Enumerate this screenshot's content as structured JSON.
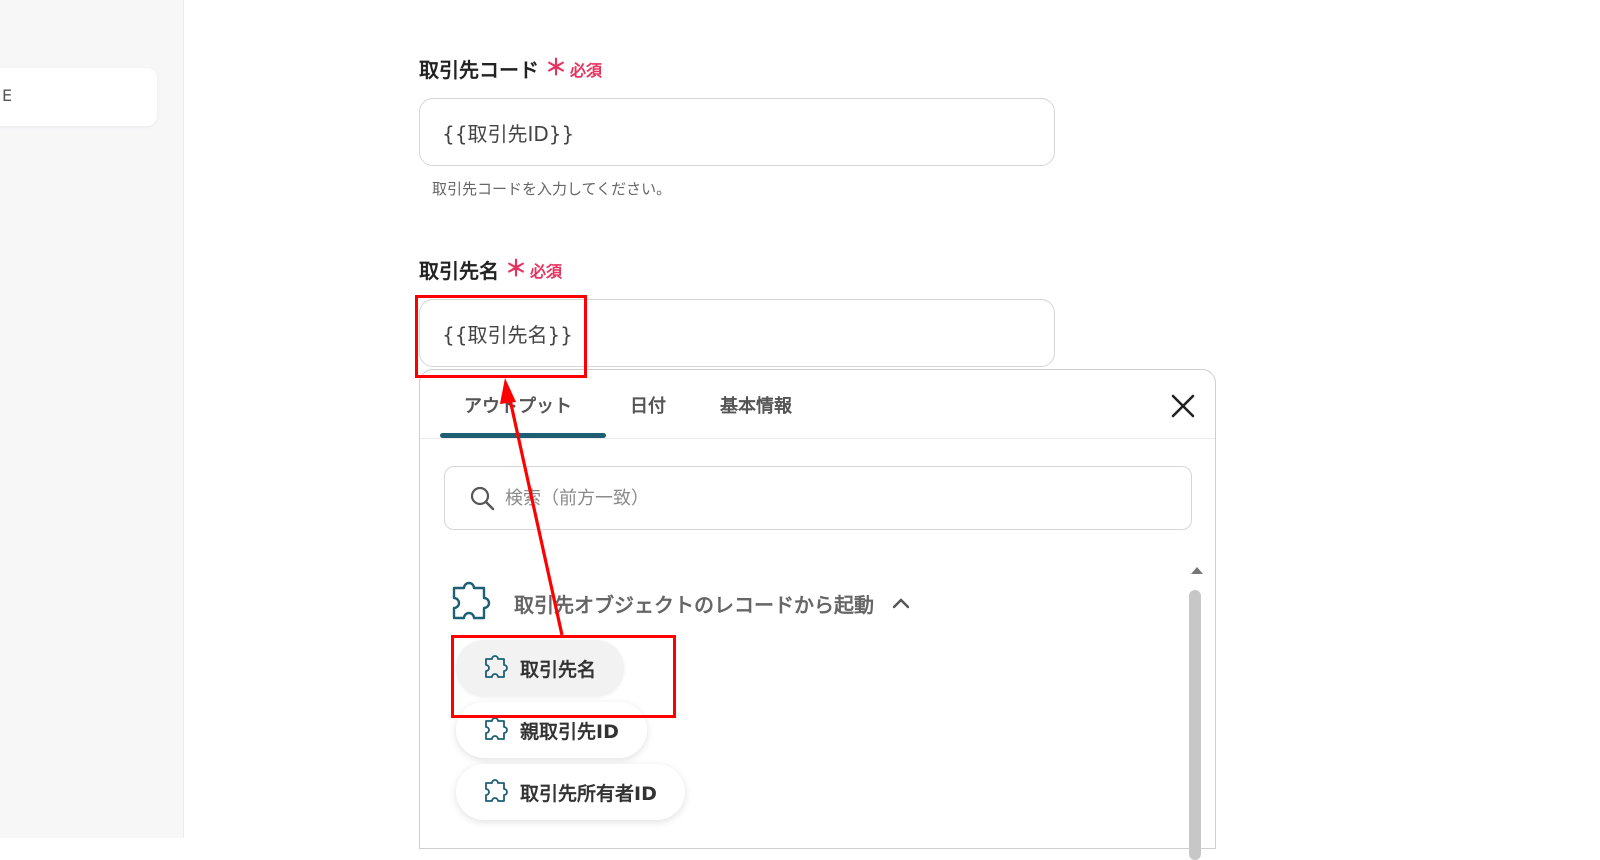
{
  "sidebar": {
    "item_label": "E"
  },
  "fields": [
    {
      "label": "取引先コード",
      "required_mark": "＊",
      "required_text": "必須",
      "value": "{{取引先ID}}",
      "help": "取引先コードを入力してください。"
    },
    {
      "label": "取引先名",
      "required_mark": "＊",
      "required_text": "必須",
      "value": "{{取引先名}}"
    }
  ],
  "panel": {
    "tabs": [
      {
        "label": "アウトプット",
        "active": true
      },
      {
        "label": "日付",
        "active": false
      },
      {
        "label": "基本情報",
        "active": false
      }
    ],
    "search_placeholder": "検索（前方一致）",
    "group_title": "取引先オブジェクトのレコードから起動",
    "items": [
      {
        "label": "取引先名",
        "icon": "puzzle-icon",
        "active": true
      },
      {
        "label": "親取引先ID",
        "icon": "puzzle-icon",
        "active": false
      },
      {
        "label": "取引先所有者ID",
        "icon": "puzzle-icon",
        "active": false
      }
    ]
  },
  "colors": {
    "required": "#e5345f",
    "tab_underline": "#1e5f74",
    "annotation": "#ff0000"
  }
}
